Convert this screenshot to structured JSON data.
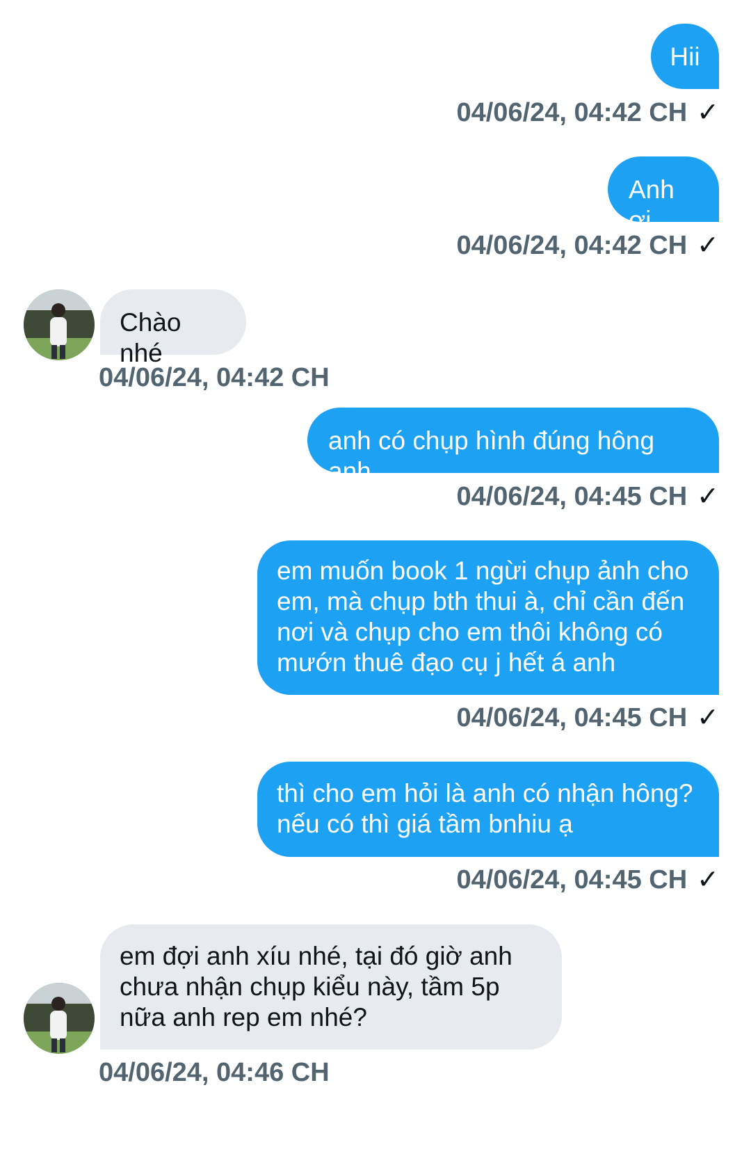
{
  "messages": [
    {
      "direction": "out",
      "text": "Hii",
      "time": "04/06/24, 04:42 CH",
      "status_icon": "check-icon",
      "check": "✓"
    },
    {
      "direction": "out",
      "text": "Anh ơi",
      "time": "04/06/24, 04:42 CH",
      "status_icon": "check-icon",
      "check": "✓"
    },
    {
      "direction": "in",
      "text": "Chào nhé",
      "time": "04/06/24, 04:42 CH",
      "avatar": "user-avatar"
    },
    {
      "direction": "out",
      "text": "anh có chụp hình đúng hông anh",
      "time": "04/06/24, 04:45 CH",
      "status_icon": "check-icon",
      "check": "✓"
    },
    {
      "direction": "out",
      "text": "em muốn book 1 ngừi chụp ảnh cho\nem, mà chụp bth thui à, chỉ cần đến\nnơi và chụp cho em thôi không có\nmướn thuê đạo cụ j hết á anh",
      "time": "04/06/24, 04:45 CH",
      "status_icon": "check-icon",
      "check": "✓"
    },
    {
      "direction": "out",
      "text": "thì cho em hỏi là anh có nhận hông?\nnếu có thì giá tầm bnhiu ạ",
      "time": "04/06/24, 04:45 CH",
      "status_icon": "check-icon",
      "check": "✓"
    },
    {
      "direction": "in",
      "text": "em đợi anh xíu nhé, tại đó giờ anh\nchưa nhận chụp kiểu này, tầm 5p\nnữa anh rep em nhé?",
      "time": "04/06/24, 04:46 CH",
      "avatar": "user-avatar"
    }
  ],
  "colors": {
    "outgoing_bubble": "#1da1f2",
    "incoming_bubble": "#e7ebef",
    "timestamp": "#536471"
  }
}
